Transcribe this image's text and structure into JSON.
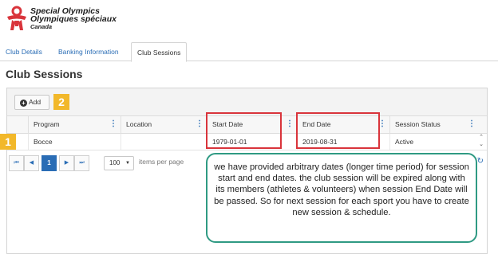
{
  "logo": {
    "line1": "Special Olympics",
    "line2": "Olympiques spéciaux",
    "line3": "Canada",
    "brand_color": "#d9343b"
  },
  "tabs": [
    {
      "label": "Club Details",
      "active": false
    },
    {
      "label": "Banking Information",
      "active": false
    },
    {
      "label": "Club Sessions",
      "active": true
    }
  ],
  "page_title": "Club Sessions",
  "toolbar": {
    "add_label": "Add",
    "add_icon": "plus-circle-icon"
  },
  "columns": [
    "Program",
    "Location",
    "Start Date",
    "End Date",
    "Session Status"
  ],
  "rows": [
    {
      "program": "Bocce",
      "location": "",
      "start_date": "1979-01-01",
      "end_date": "2019-08-31",
      "status": "Active"
    }
  ],
  "pager": {
    "first": "⏮",
    "prev": "◀",
    "current_page": "1",
    "next": "▶",
    "last": "⏭",
    "page_size": "100",
    "items_label": "items per page"
  },
  "annotations": {
    "badge1": "1",
    "badge2": "2",
    "callout": "we have provided arbitrary dates (longer time period) for session start and end dates. the club session will be expired along with its members (athletes  & volunteers) when session End Date will be passed. So for next session for each sport you have to create new session & schedule."
  },
  "colors": {
    "accent": "#2a6db5",
    "highlight": "#d9343b",
    "badge": "#f2b82a",
    "callout_border": "#2f9a83"
  }
}
